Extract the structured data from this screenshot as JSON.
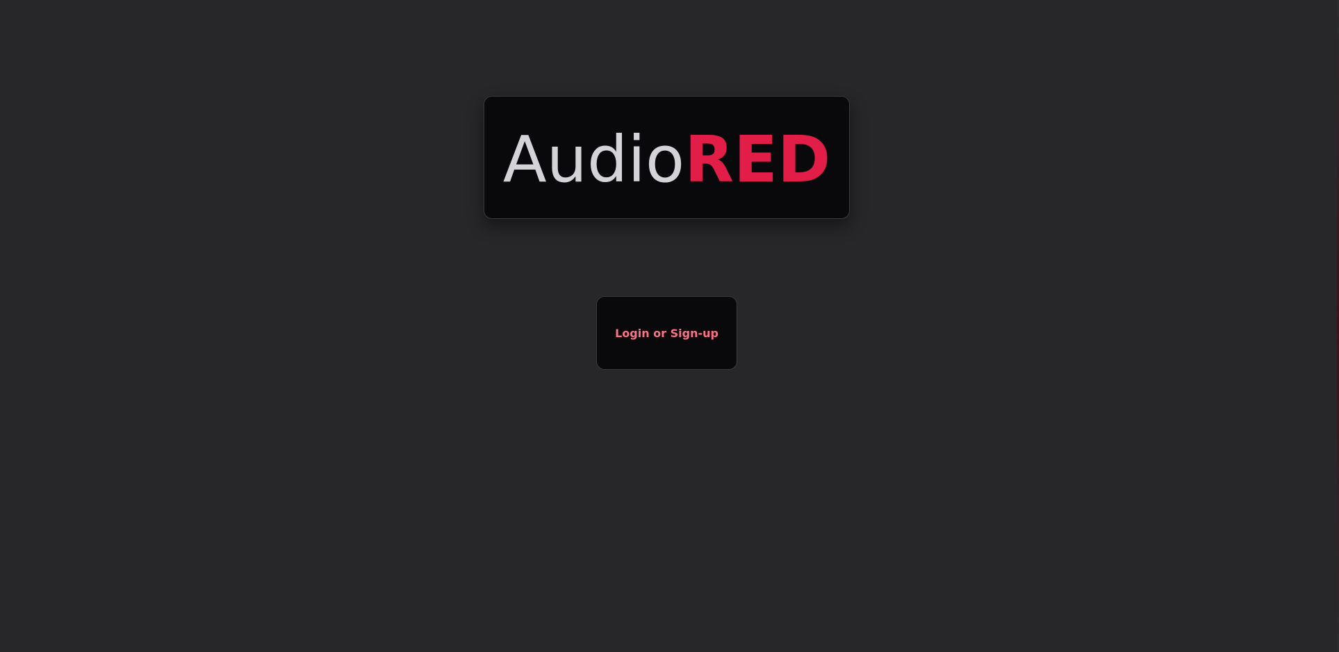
{
  "logo": {
    "text_primary": "Audio",
    "text_accent": "RED"
  },
  "actions": {
    "login_label": "Login or Sign-up"
  },
  "colors": {
    "page_background": "#27272a",
    "card_background": "#09090b",
    "logo_primary": "#d4d4d8",
    "accent_red": "#e11d48",
    "button_text": "#fb7185"
  }
}
